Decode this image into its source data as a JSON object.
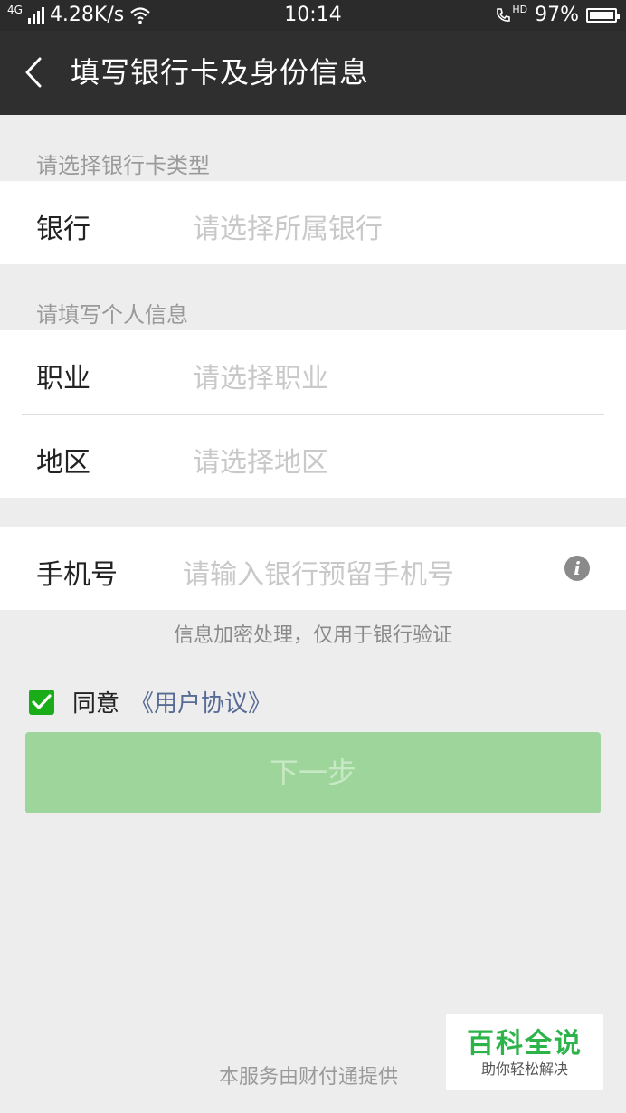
{
  "status_bar": {
    "network": "4G",
    "speed": "4.28K/s",
    "time": "10:14",
    "hd": "HD",
    "battery": "97%"
  },
  "header": {
    "title": "填写银行卡及身份信息"
  },
  "sections": {
    "bank_type_label": "请选择银行卡类型",
    "personal_info_label": "请填写个人信息"
  },
  "fields": {
    "bank": {
      "label": "银行",
      "placeholder": "请选择所属银行"
    },
    "occupation": {
      "label": "职业",
      "placeholder": "请选择职业"
    },
    "region": {
      "label": "地区",
      "placeholder": "请选择地区"
    },
    "phone": {
      "label": "手机号",
      "placeholder": "请输入银行预留手机号"
    }
  },
  "note": "信息加密处理，仅用于银行验证",
  "agreement": {
    "agree_text": "同意",
    "link_text": "《用户协议》"
  },
  "next_button": "下一步",
  "footer": "本服务由财付通提供",
  "watermark": {
    "main": "百科全说",
    "sub": "助你轻松解决"
  },
  "colors": {
    "header_bg": "#2f2f2f",
    "accent_green": "#1aad19",
    "button_disabled": "#9ed59a",
    "link_blue": "#576b95"
  }
}
